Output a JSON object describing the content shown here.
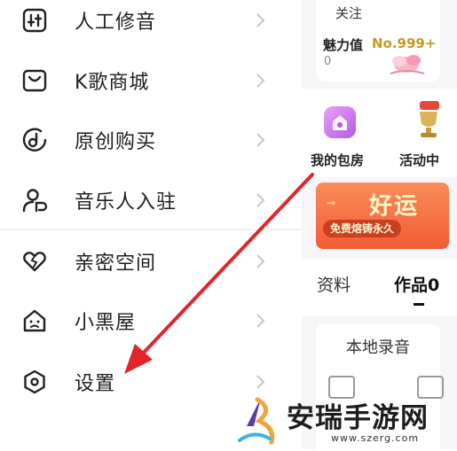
{
  "menu": {
    "items": [
      {
        "label": "人工修音",
        "icon": "equalizer-icon"
      },
      {
        "label": "K歌商城",
        "icon": "shopping-bag-icon"
      },
      {
        "label": "原创购买",
        "icon": "music-note-circle-icon"
      },
      {
        "label": "音乐人入驻",
        "icon": "musician-person-icon"
      },
      {
        "label": "亲密空间",
        "icon": "heart-pair-icon"
      },
      {
        "label": "小黑屋",
        "icon": "house-sad-face-icon"
      },
      {
        "label": "设置",
        "icon": "settings-hexagon-icon"
      }
    ]
  },
  "profile": {
    "follow_label": "关注",
    "charm_label": "魅力值",
    "charm_rank": "No.999+",
    "charm_value": "0",
    "room_label": "我的包房",
    "activity_label": "活动中",
    "banner_title": "好运",
    "banner_sub": "免费熔铸永久",
    "tab_info": "资料",
    "tab_works": "作品0",
    "local_recording": "本地录音"
  },
  "watermark": {
    "title": "安瑞手游网",
    "url": "www.szerg.com"
  },
  "colors": {
    "arrow": "#e0262a",
    "accent": "#c79a1f",
    "banner": "#f25c33"
  }
}
